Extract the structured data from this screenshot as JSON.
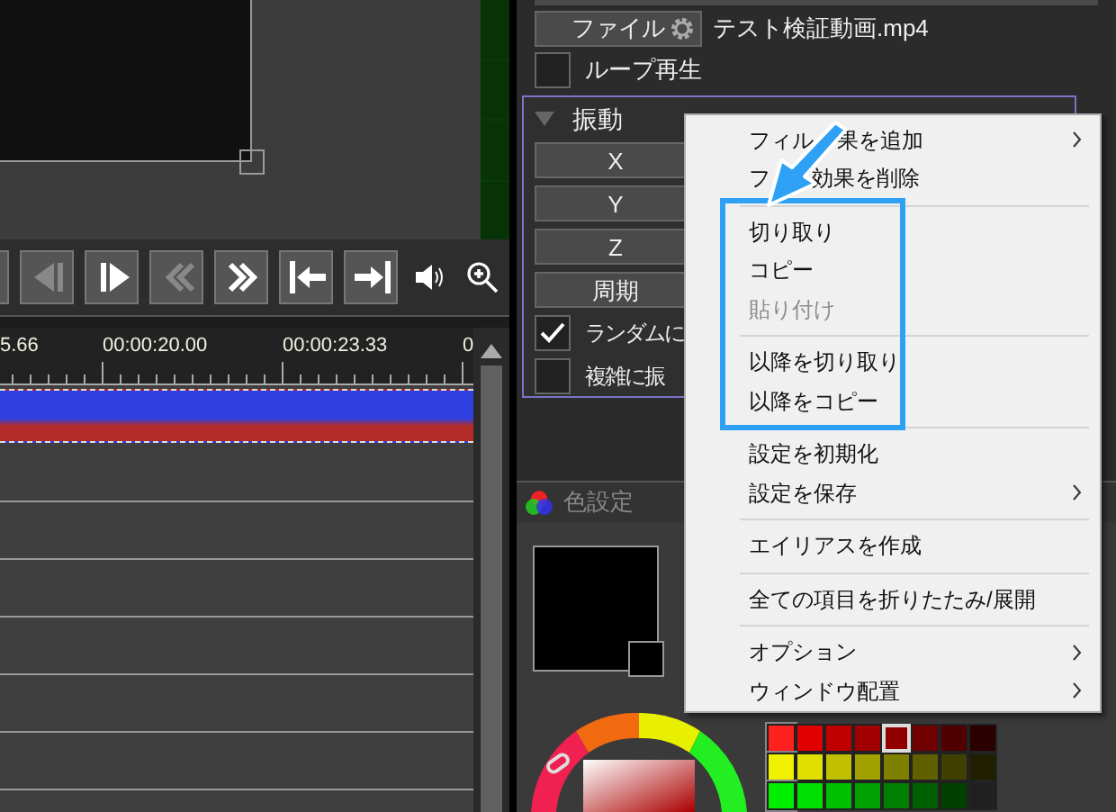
{
  "timeline": {
    "ruler_labels": [
      "5.66",
      "00:00:20.00",
      "00:00:23.33",
      "0"
    ]
  },
  "object_panel": {
    "file_button": "ファイル",
    "file_name": "テスト検証動画.mp4",
    "loop": {
      "label": "ループ再生",
      "checked": false
    },
    "filter": {
      "title": "振動",
      "expanded": true,
      "buttons": [
        "X",
        "Y",
        "Z",
        "周期"
      ],
      "checkboxes": [
        {
          "label": "ランダムに",
          "checked": true
        },
        {
          "label": "複雑に振",
          "checked": false
        }
      ]
    }
  },
  "color_panel": {
    "title": "色設定"
  },
  "context_menu": {
    "items": [
      {
        "kind": "item",
        "label_parts": [
          "フィル",
          "果を追加"
        ],
        "submenu": true,
        "disabled": false
      },
      {
        "kind": "item",
        "label_parts": [
          "フ",
          "効果を削除"
        ],
        "submenu": false,
        "disabled": false
      },
      {
        "kind": "separator"
      },
      {
        "kind": "item",
        "label": "切り取り",
        "submenu": false,
        "disabled": false
      },
      {
        "kind": "item",
        "label": "コピー",
        "submenu": false,
        "disabled": false
      },
      {
        "kind": "item",
        "label": "貼り付け",
        "submenu": false,
        "disabled": true
      },
      {
        "kind": "separator"
      },
      {
        "kind": "item",
        "label": "以降を切り取り",
        "submenu": false,
        "disabled": false
      },
      {
        "kind": "item",
        "label": "以降をコピー",
        "submenu": false,
        "disabled": false
      },
      {
        "kind": "separator"
      },
      {
        "kind": "item",
        "label": "設定を初期化",
        "submenu": false,
        "disabled": false
      },
      {
        "kind": "item",
        "label": "設定を保存",
        "submenu": true,
        "disabled": false
      },
      {
        "kind": "separator"
      },
      {
        "kind": "item",
        "label": "エイリアスを作成",
        "submenu": false,
        "disabled": false
      },
      {
        "kind": "separator"
      },
      {
        "kind": "item",
        "label": "全ての項目を折りたたみ/展開",
        "submenu": false,
        "disabled": false
      },
      {
        "kind": "separator"
      },
      {
        "kind": "item",
        "label": "オプション",
        "submenu": true,
        "disabled": false
      },
      {
        "kind": "item",
        "label": "ウィンドウ配置",
        "submenu": true,
        "disabled": false
      }
    ]
  }
}
